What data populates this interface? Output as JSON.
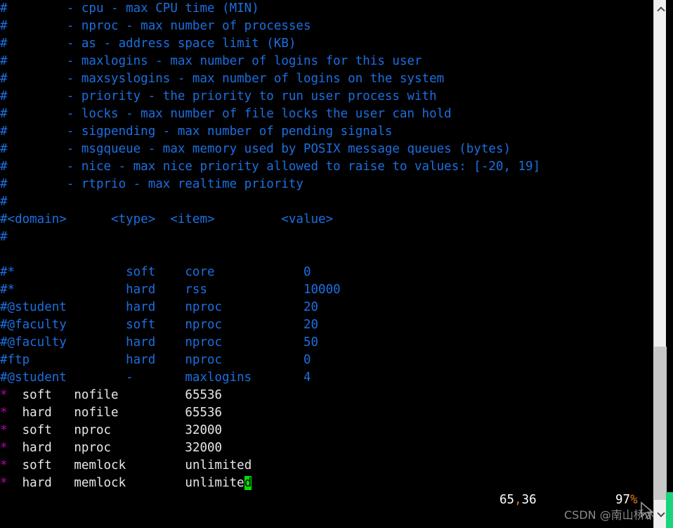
{
  "window": {
    "app": "vim",
    "background": "#000000",
    "foreground": "#E8E8E8"
  },
  "colors": {
    "comment_blue": "#1C6FE0",
    "normal_text": "#E8E8E8",
    "special_magenta": "#B500B5",
    "cursor_green": "#00E000",
    "ruler_orange": "#E07A1C",
    "scrollbar_track": "#F0F0F0",
    "scrollbar_thumb": "#C8C8C8",
    "scrollbar_accent": "#19D37C"
  },
  "editor": {
    "lines": [
      {
        "id": "l01",
        "kind": "comment",
        "text": "#        - cpu - max CPU time (MIN)"
      },
      {
        "id": "l02",
        "kind": "comment",
        "text": "#        - nproc - max number of processes"
      },
      {
        "id": "l03",
        "kind": "comment",
        "text": "#        - as - address space limit (KB)"
      },
      {
        "id": "l04",
        "kind": "comment",
        "text": "#        - maxlogins - max number of logins for this user"
      },
      {
        "id": "l05",
        "kind": "comment",
        "text": "#        - maxsyslogins - max number of logins on the system"
      },
      {
        "id": "l06",
        "kind": "comment",
        "text": "#        - priority - the priority to run user process with"
      },
      {
        "id": "l07",
        "kind": "comment",
        "text": "#        - locks - max number of file locks the user can hold"
      },
      {
        "id": "l08",
        "kind": "comment",
        "text": "#        - sigpending - max number of pending signals"
      },
      {
        "id": "l09",
        "kind": "comment",
        "text": "#        - msgqueue - max memory used by POSIX message queues (bytes)"
      },
      {
        "id": "l10",
        "kind": "comment",
        "text": "#        - nice - max nice priority allowed to raise to values: [-20, 19]"
      },
      {
        "id": "l11",
        "kind": "comment",
        "text": "#        - rtprio - max realtime priority"
      },
      {
        "id": "l12",
        "kind": "comment",
        "text": "#"
      },
      {
        "id": "l13",
        "kind": "comment",
        "text": "#<domain>      <type>  <item>         <value>"
      },
      {
        "id": "l14",
        "kind": "comment",
        "text": "#"
      },
      {
        "id": "l15",
        "kind": "blank",
        "text": ""
      },
      {
        "id": "l16",
        "kind": "comment",
        "text": "#*               soft    core            0"
      },
      {
        "id": "l17",
        "kind": "comment",
        "text": "#*               hard    rss             10000"
      },
      {
        "id": "l18",
        "kind": "comment",
        "text": "#@student        hard    nproc           20"
      },
      {
        "id": "l19",
        "kind": "comment",
        "text": "#@faculty        soft    nproc           20"
      },
      {
        "id": "l20",
        "kind": "comment",
        "text": "#@faculty        hard    nproc           50"
      },
      {
        "id": "l21",
        "kind": "comment",
        "text": "#ftp             hard    nproc           0"
      },
      {
        "id": "l22",
        "kind": "comment",
        "text": "#@student        -       maxlogins       4"
      },
      {
        "id": "l23",
        "kind": "limit",
        "star": "*",
        "rest": "  soft   nofile         65536"
      },
      {
        "id": "l24",
        "kind": "limit",
        "star": "*",
        "rest": "  hard   nofile         65536"
      },
      {
        "id": "l25",
        "kind": "limit",
        "star": "*",
        "rest": "  soft   nproc          32000"
      },
      {
        "id": "l26",
        "kind": "limit",
        "star": "*",
        "rest": "  hard   nproc          32000"
      },
      {
        "id": "l27",
        "kind": "limit",
        "star": "*",
        "rest": "  soft   memlock        unlimited"
      },
      {
        "id": "l28",
        "kind": "limit-cursor",
        "star": "*",
        "before": "  hard   memlock        unlimite",
        "cursor": "d",
        "after": ""
      }
    ]
  },
  "statusline": {
    "position": "65,36",
    "position_line": "65",
    "position_sep": ",",
    "position_col": "36",
    "percent": "97%",
    "percent_num": "97",
    "percent_sign": "%"
  },
  "watermark": {
    "text": "CSDN @南山桥木"
  },
  "scrollbar": {
    "up_arrow_icon": "chevron-up-icon",
    "down_arrow_icon": "chevron-down-icon",
    "thumb_top_px": "493",
    "thumb_height_px": "218"
  }
}
